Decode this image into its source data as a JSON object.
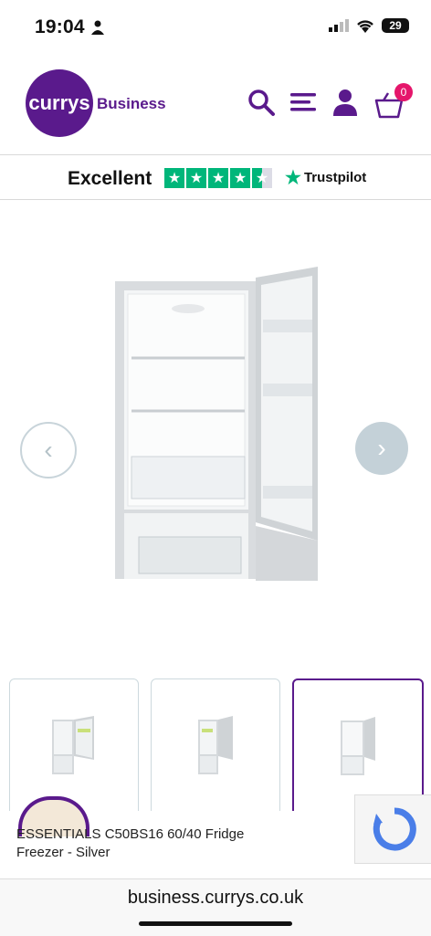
{
  "status": {
    "time": "19:04",
    "battery": "29"
  },
  "header": {
    "logo_text": "currys",
    "logo_sub": "Business",
    "basket_count": "0"
  },
  "trust": {
    "rating": "Excellent",
    "brand": "Trustpilot"
  },
  "gallery": {
    "prev_label": "‹",
    "next_label": "›"
  },
  "product": {
    "title": "ESSENTIALS C50BS16 60/40 Fridge Freezer - Silver"
  },
  "browser": {
    "url": "business.currys.co.uk"
  },
  "colors": {
    "brand": "#5a1a8c",
    "badge": "#e5166b",
    "trustpilot": "#00b67a"
  }
}
